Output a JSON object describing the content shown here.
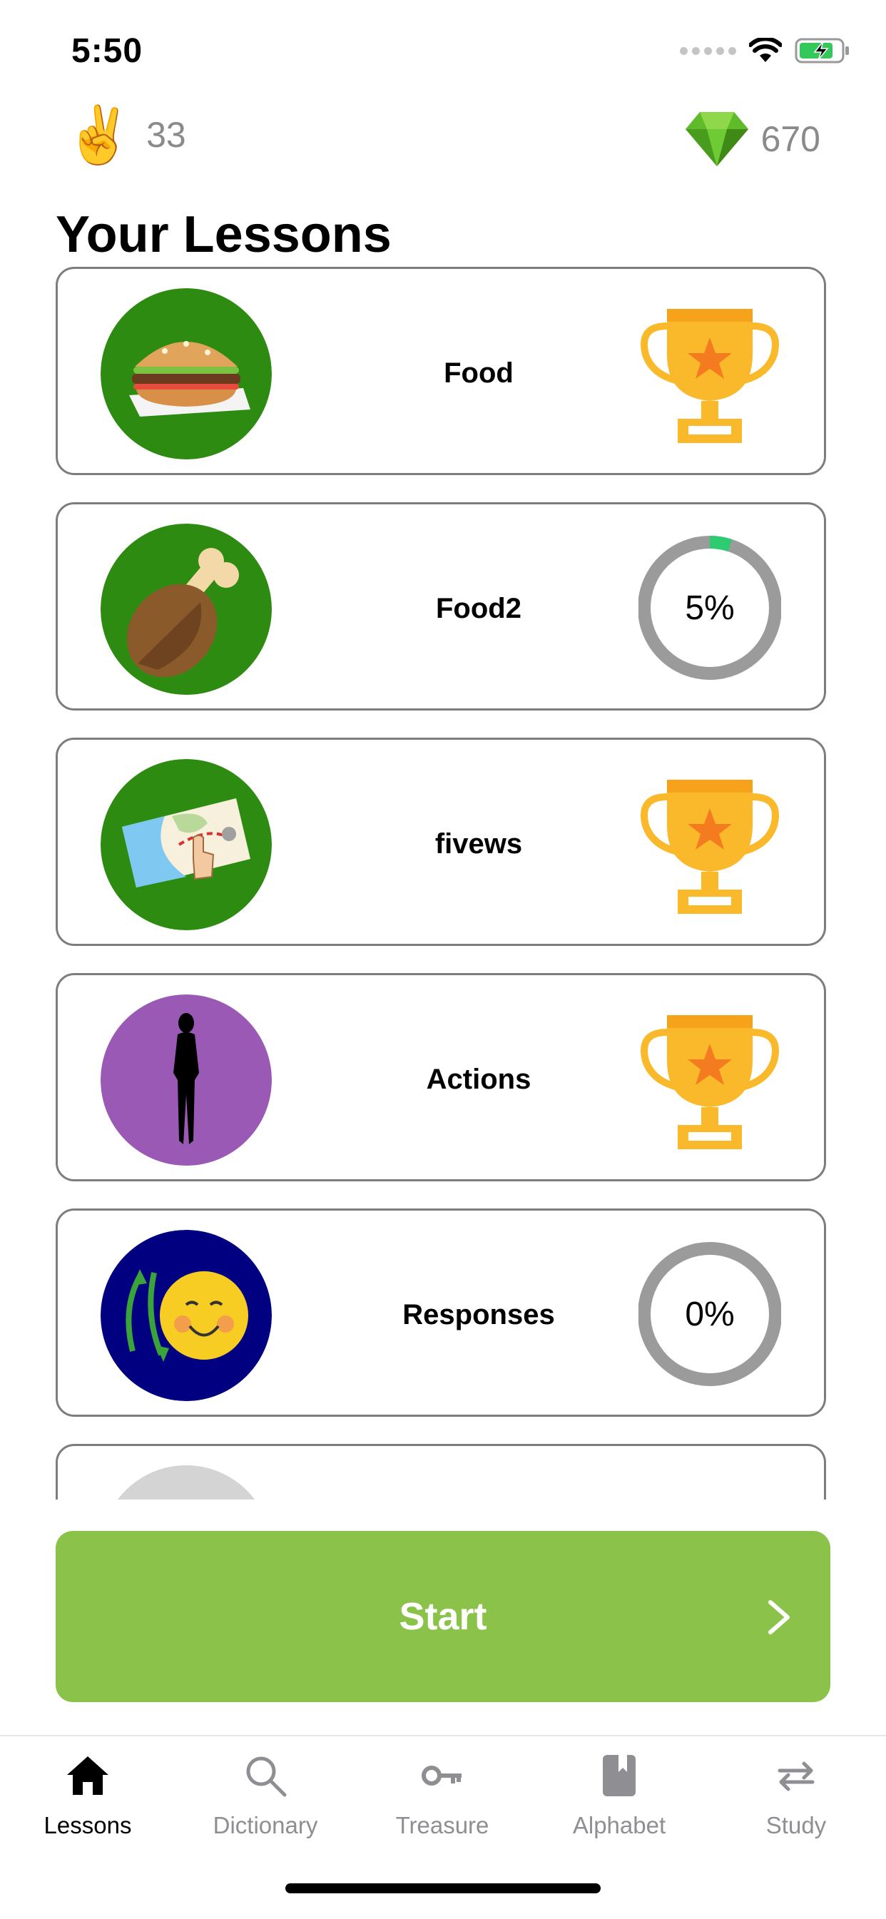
{
  "status_bar": {
    "time": "5:50",
    "icons": [
      "signal-dots",
      "wifi-icon",
      "battery-charging-icon"
    ]
  },
  "header": {
    "streak_icon": "victory-hand-emoji",
    "streak_count": "33",
    "gem_icon": "green-gem-icon",
    "gem_count": "670"
  },
  "page_title": "Your Lessons",
  "lessons": [
    {
      "name": "Food",
      "icon": "hamburger",
      "circle_color": "#2e8b12",
      "status": "trophy"
    },
    {
      "name": "Food2",
      "icon": "chicken-leg",
      "circle_color": "#2e8b12",
      "status": "progress",
      "progress_label": "5%",
      "progress": 0.05
    },
    {
      "name": "fivews",
      "icon": "map",
      "circle_color": "#2e8b12",
      "status": "trophy"
    },
    {
      "name": "Actions",
      "icon": "woman-silhouette",
      "circle_color": "#9b59b6",
      "status": "trophy"
    },
    {
      "name": "Responses",
      "icon": "smiley-arrows",
      "circle_color": "#000080",
      "status": "progress",
      "progress_label": "0%",
      "progress": 0.0
    }
  ],
  "start_button": {
    "label": "Start",
    "icon": "chevron-right-icon",
    "color": "#8bc34a"
  },
  "tabs": [
    {
      "label": "Lessons",
      "icon": "home-icon",
      "active": true
    },
    {
      "label": "Dictionary",
      "icon": "search-icon",
      "active": false
    },
    {
      "label": "Treasure",
      "icon": "key-icon",
      "active": false
    },
    {
      "label": "Alphabet",
      "icon": "book-icon",
      "active": false
    },
    {
      "label": "Study",
      "icon": "repeat-icon",
      "active": false
    }
  ],
  "colors": {
    "accent": "#8bc34a",
    "trophy": "#f9b92b",
    "ring_track": "#9b9b9b",
    "ring_fill": "#2ecc71"
  }
}
